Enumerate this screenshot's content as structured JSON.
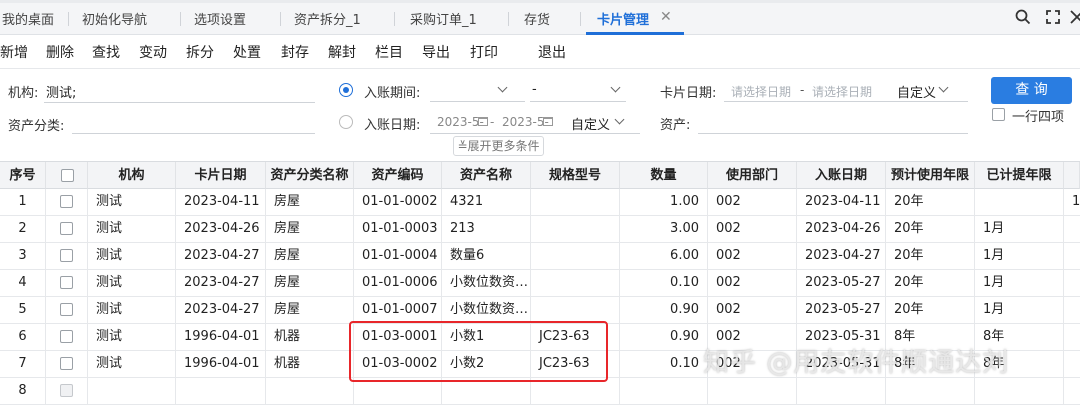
{
  "tabs": [
    {
      "label": "我的桌面"
    },
    {
      "label": "初始化导航"
    },
    {
      "label": "选项设置"
    },
    {
      "label": "资产拆分_1"
    },
    {
      "label": "采购订单_1"
    },
    {
      "label": "存货"
    },
    {
      "label": "卡片管理",
      "active": true
    }
  ],
  "tab_close": "✕",
  "toolbar": [
    "新增",
    "删除",
    "查找",
    "变动",
    "拆分",
    "处置",
    "封存",
    "解封",
    "栏目",
    "导出",
    "打印",
    "退出"
  ],
  "filter": {
    "org_label": "机构:",
    "org_value": "测试;",
    "asset_class_label": "资产分类:",
    "period_label": "入账期间:",
    "period_second": "-",
    "entry_date_label": "入账日期:",
    "entry_date_from": "2023-5-",
    "entry_date_sep": "-",
    "entry_date_to": "2023-5-",
    "entry_date_mode": "自定义",
    "card_date_label": "卡片日期:",
    "card_date_from_ph": "请选择日期",
    "card_date_sep": "-",
    "card_date_to_ph": "请选择日期",
    "card_date_mode": "自定义",
    "asset_label": "资产:",
    "query_button": "查 询",
    "one_row_label": "一行四项",
    "expand_label": "展开更多条件"
  },
  "table": {
    "columns": [
      "序号",
      "",
      "机构",
      "卡片日期",
      "资产分类名称",
      "资产编码",
      "资产名称",
      "规格型号",
      "数量",
      "使用部门",
      "入账日期",
      "预计使用年限",
      "已计提年限"
    ],
    "rows": [
      {
        "no": "1",
        "org": "测试",
        "card_date": "2023-04-11",
        "class": "房屋",
        "code": "01-01-0002",
        "name": "4321",
        "spec": "",
        "qty": "1.00",
        "dept": "002",
        "entry": "2023-04-11",
        "life": "20年",
        "accrued": "",
        "extra": "1"
      },
      {
        "no": "2",
        "org": "测试",
        "card_date": "2023-04-26",
        "class": "房屋",
        "code": "01-01-0003",
        "name": "213",
        "spec": "",
        "qty": "3.00",
        "dept": "002",
        "entry": "2023-04-26",
        "life": "20年",
        "accrued": "1月",
        "extra": ""
      },
      {
        "no": "3",
        "org": "测试",
        "card_date": "2023-04-27",
        "class": "房屋",
        "code": "01-01-0004",
        "name": "数量6",
        "spec": "",
        "qty": "6.00",
        "dept": "002",
        "entry": "2023-04-27",
        "life": "20年",
        "accrued": "1月",
        "extra": ""
      },
      {
        "no": "4",
        "org": "测试",
        "card_date": "2023-04-27",
        "class": "房屋",
        "code": "01-01-0006",
        "name": "小数位数资…",
        "spec": "",
        "qty": "0.10",
        "dept": "002",
        "entry": "2023-05-27",
        "life": "20年",
        "accrued": "1月",
        "extra": ""
      },
      {
        "no": "5",
        "org": "测试",
        "card_date": "2023-04-27",
        "class": "房屋",
        "code": "01-01-0007",
        "name": "小数位数资…",
        "spec": "",
        "qty": "0.90",
        "dept": "002",
        "entry": "2023-05-27",
        "life": "20年",
        "accrued": "1月",
        "extra": ""
      },
      {
        "no": "6",
        "org": "测试",
        "card_date": "1996-04-01",
        "class": "机器",
        "code": "01-03-0001",
        "name": "小数1",
        "spec": "JC23-63",
        "qty": "0.90",
        "dept": "002",
        "entry": "2023-05-31",
        "life": "8年",
        "accrued": "8年",
        "extra": ""
      },
      {
        "no": "7",
        "org": "测试",
        "card_date": "1996-04-01",
        "class": "机器",
        "code": "01-03-0002",
        "name": "小数2",
        "spec": "JC23-63",
        "qty": "0.10",
        "dept": "002",
        "entry": "2023-05-31",
        "life": "8年",
        "accrued": "8年",
        "extra": ""
      },
      {
        "no": "8",
        "org": "",
        "card_date": "",
        "class": "",
        "code": "",
        "name": "",
        "spec": "",
        "qty": "",
        "dept": "",
        "entry": "",
        "life": "",
        "accrued": "",
        "extra": ""
      }
    ]
  },
  "watermark": "知乎 @用友软件顺通达刘",
  "colors": {
    "accent": "#1f6fd8",
    "query_button": "#2a7de1",
    "highlight_box": "#e8262a"
  }
}
